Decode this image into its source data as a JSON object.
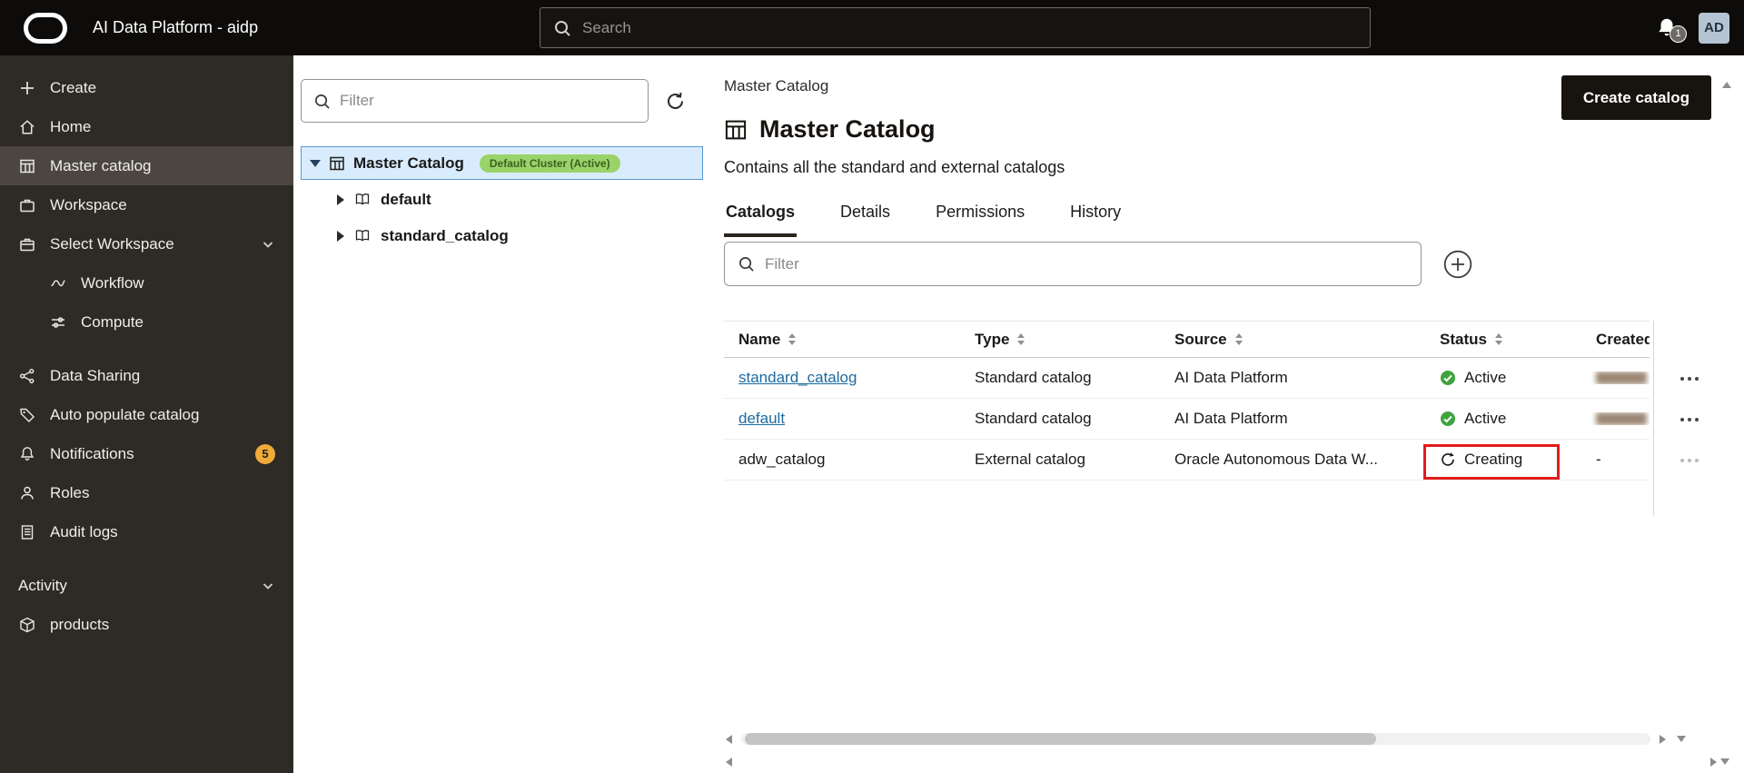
{
  "header": {
    "app_title": "AI Data Platform - aidp",
    "search_placeholder": "Search",
    "notification_count": "1",
    "avatar_initials": "AD"
  },
  "sidebar": {
    "items": [
      {
        "label": "Create",
        "icon": "plus-icon"
      },
      {
        "label": "Home",
        "icon": "home-icon"
      },
      {
        "label": "Master catalog",
        "icon": "catalog-icon",
        "selected": true
      },
      {
        "label": "Workspace",
        "icon": "briefcase-icon"
      },
      {
        "label": "Select Workspace",
        "icon": "briefcase-icon",
        "expandable": true
      },
      {
        "label": "Workflow",
        "icon": "workflow-icon",
        "indent": true
      },
      {
        "label": "Compute",
        "icon": "compute-icon",
        "indent": true
      },
      {
        "label": "Data Sharing",
        "icon": "share-icon"
      },
      {
        "label": "Auto populate catalog",
        "icon": "tag-icon"
      },
      {
        "label": "Notifications",
        "icon": "bell-icon",
        "badge": "5"
      },
      {
        "label": "Roles",
        "icon": "person-icon"
      },
      {
        "label": "Audit logs",
        "icon": "document-icon"
      },
      {
        "label": "Activity",
        "expandable": true
      },
      {
        "label": "products",
        "icon": "cube-icon"
      }
    ]
  },
  "tree": {
    "filter_placeholder": "Filter",
    "root": {
      "label": "Master Catalog",
      "badge": "Default Cluster (Active)"
    },
    "children": [
      {
        "label": "default"
      },
      {
        "label": "standard_catalog"
      }
    ]
  },
  "main": {
    "breadcrumb": "Master Catalog",
    "create_button": "Create catalog",
    "title": "Master Catalog",
    "subtitle": "Contains all the standard and external catalogs",
    "tabs": [
      {
        "label": "Catalogs",
        "active": true
      },
      {
        "label": "Details"
      },
      {
        "label": "Permissions"
      },
      {
        "label": "History"
      }
    ],
    "filter_placeholder": "Filter",
    "table": {
      "columns": [
        "Name",
        "Type",
        "Source",
        "Status",
        "Created"
      ],
      "rows": [
        {
          "name": "standard_catalog",
          "type": "Standard catalog",
          "source": "AI Data Platform",
          "status": "Active",
          "created": "",
          "created_redacted": true,
          "name_is_link": true
        },
        {
          "name": "default",
          "type": "Standard catalog",
          "source": "AI Data Platform",
          "status": "Active",
          "created": "",
          "created_redacted": true,
          "name_is_link": true
        },
        {
          "name": "adw_catalog",
          "type": "External catalog",
          "source": "Oracle Autonomous Data W...",
          "status": "Creating",
          "created": "-",
          "annotated": true
        }
      ]
    }
  },
  "colors": {
    "link": "#1c6ba0",
    "status_active_green": "#3fa33f",
    "cluster_badge_bg": "#9ad36a",
    "cluster_badge_text": "#3c611c",
    "notification_badge_orange": "#efaa3a",
    "annotation_red": "#e11c1c",
    "create_button_bg": "#17130e"
  }
}
